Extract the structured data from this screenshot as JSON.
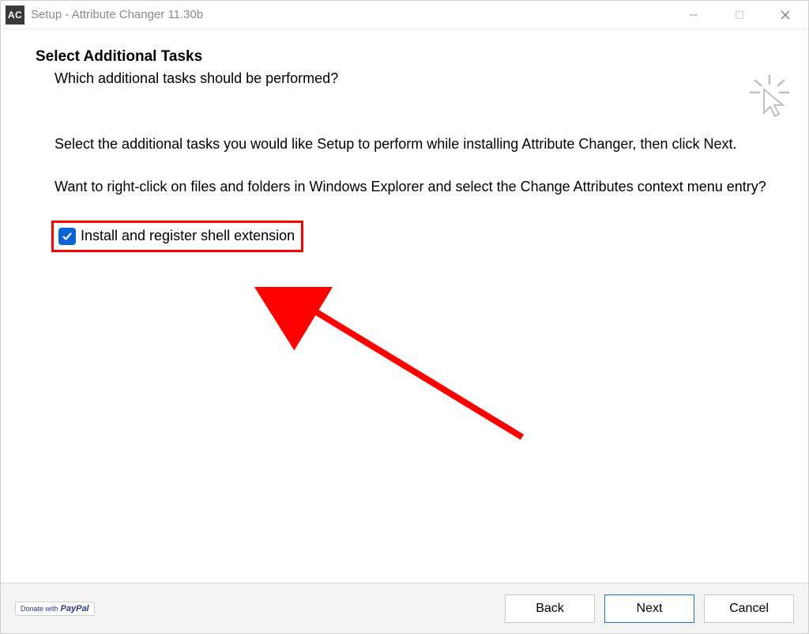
{
  "titlebar": {
    "app_icon_text": "AC",
    "title": "Setup - Attribute Changer 11.30b"
  },
  "page": {
    "heading": "Select Additional Tasks",
    "subheading": "Which additional tasks should be performed?",
    "paragraph1": "Select the additional tasks you would like Setup to perform while installing Attribute Changer, then click Next.",
    "paragraph2": "Want to right-click on files and folders in Windows Explorer and select the Change Attributes context menu entry?"
  },
  "checkbox": {
    "label": "Install and register shell extension",
    "checked": true
  },
  "footer": {
    "paypal_prefix": "Donate with",
    "paypal_brand": "PayPal",
    "back": "Back",
    "next": "Next",
    "cancel": "Cancel"
  }
}
